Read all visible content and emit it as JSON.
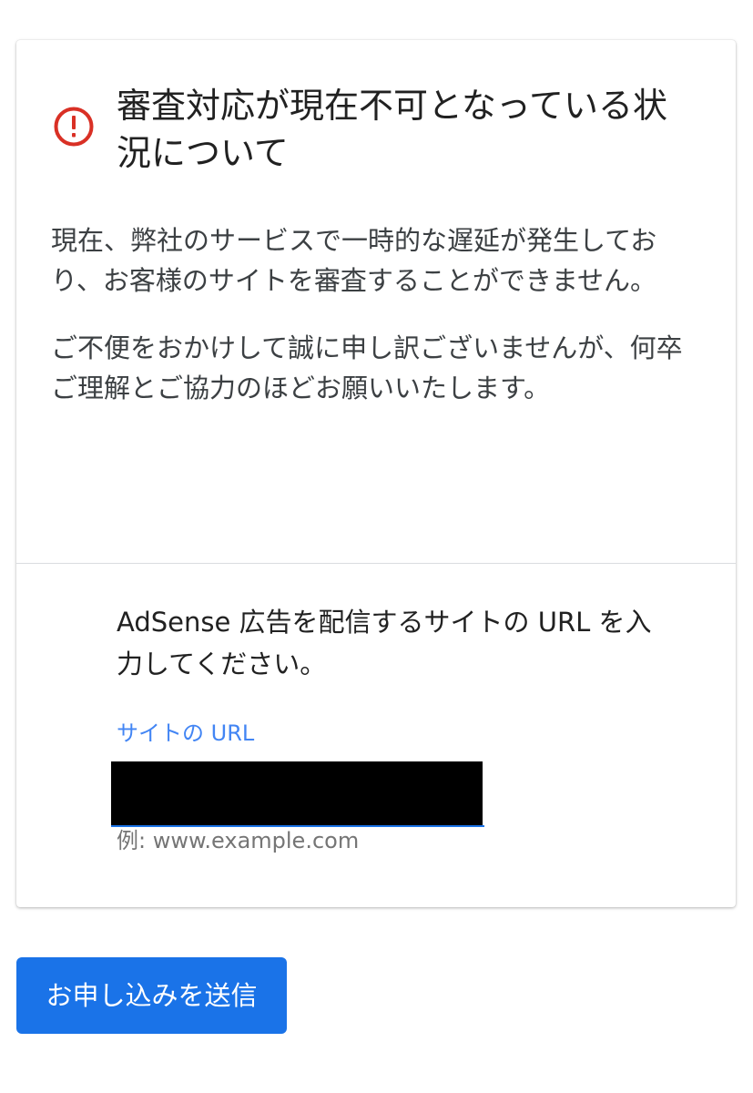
{
  "alert": {
    "icon": "error-circle-icon",
    "icon_color": "#d93025",
    "title": "審査対応が現在不可となっている状況について",
    "paragraphs": [
      "現在、弊社のサービスで一時的な遅延が発生しており、お客様のサイトを審査することができません。",
      "ご不便をおかけして誠に申し訳ございませんが、何卒ご理解とご協力のほどお願いいたします。"
    ]
  },
  "form": {
    "prompt": "AdSense 広告を配信するサイトの URL を入力してください。",
    "url_field": {
      "label": "サイトの URL",
      "value": "",
      "hint": "例: www.example.com",
      "label_color": "#4285f4"
    }
  },
  "actions": {
    "submit_label": "お申し込みを送信",
    "submit_color": "#1a73e8"
  }
}
